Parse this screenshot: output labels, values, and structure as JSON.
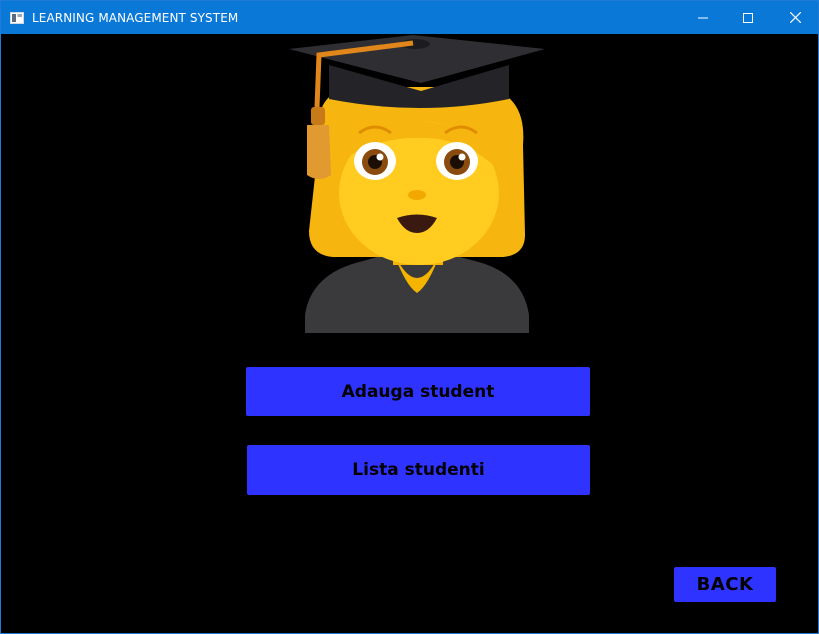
{
  "window": {
    "title": "LEARNING MANAGEMENT SYSTEM",
    "icons": [
      "app-icon",
      "minimize-icon",
      "maximize-icon",
      "close-icon"
    ]
  },
  "main": {
    "avatar_icon": "student-graduate-icon",
    "add_student_label": "Adauga student",
    "list_students_label": "Lista studenti",
    "back_label": "BACK"
  },
  "colors": {
    "titlebar": "#0a78d7",
    "background": "#000000",
    "button": "#2e33ff",
    "button_text": "#000000"
  }
}
